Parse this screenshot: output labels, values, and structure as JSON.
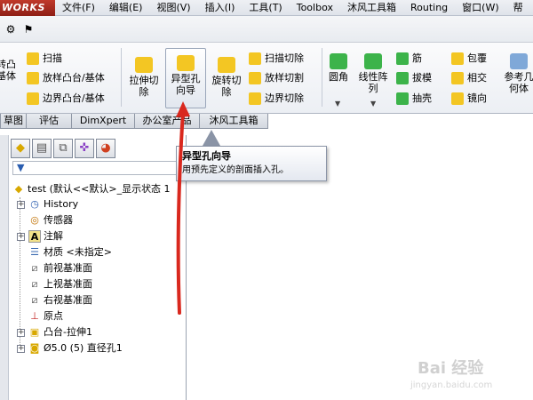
{
  "app": {
    "logo_text": "WORKS"
  },
  "menu": [
    "文件(F)",
    "编辑(E)",
    "视图(V)",
    "插入(I)",
    "工具(T)",
    "Toolbox",
    "沐风工具箱",
    "Routing",
    "窗口(W)",
    "帮"
  ],
  "ribbon": {
    "left_partial": [
      "转凸",
      "基体"
    ],
    "features_col1": [
      "扫描",
      "放样凸台/基体",
      "边界凸台/基体"
    ],
    "extrude_cut": [
      "拉伸切",
      "除"
    ],
    "hole_wizard": [
      "异型孔",
      "向导"
    ],
    "revolve_cut": [
      "旋转切",
      "除"
    ],
    "cut_col": [
      "扫描切除",
      "放样切割",
      "边界切除"
    ],
    "fillet": "圆角",
    "linear_pattern": [
      "线性阵",
      "列"
    ],
    "features_col3": [
      "筋",
      "拔模",
      "抽壳"
    ],
    "features_col4": [
      "包覆",
      "相交",
      "镜向"
    ],
    "reference": [
      "参考几",
      "何体"
    ]
  },
  "tabs": [
    "草图",
    "评估",
    "DimXpert",
    "办公室产品",
    "沐风工具箱"
  ],
  "tooltip": {
    "title": "异型孔向导",
    "body": "用预先定义的剖面插入孔。"
  },
  "tree": {
    "root": "test  (默认<<默认>_显示状态 1",
    "items": [
      "History",
      "传感器",
      "注解",
      "材质 <未指定>",
      "前视基准面",
      "上视基准面",
      "右视基准面",
      "原点",
      "凸台-拉伸1",
      "Ø5.0 (5) 直径孔1"
    ]
  },
  "watermark": {
    "text": "Bai 经验",
    "sub": "jingyan.baidu.com"
  },
  "colors": {
    "accent": "#c0392b",
    "arrow": "#d9281e",
    "icon_yellow": "#f3c623",
    "icon_green": "#3cb34a"
  }
}
